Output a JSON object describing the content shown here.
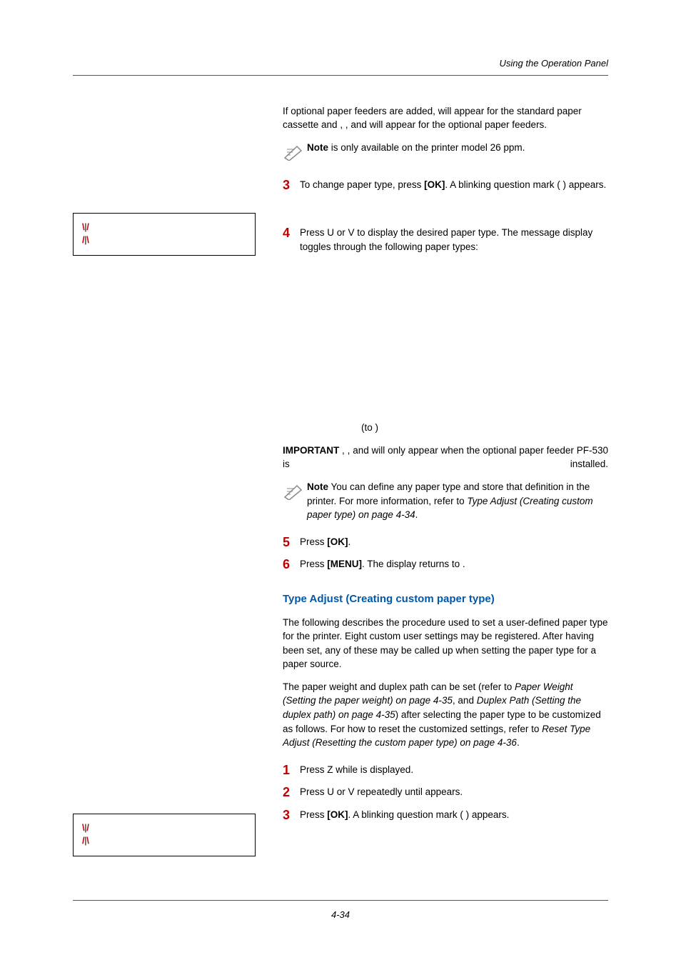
{
  "running_header": "Using the Operation Panel",
  "intro_paragraph": {
    "p1a": "If optional paper feeders are added, ",
    "p1b": " will appear for the standard paper cassette and ",
    "p1c": ", ",
    "p1d": ", and ",
    "p1e": " will appear for the optional paper feeders."
  },
  "note1": {
    "label": "Note",
    "text_a": " is only available on the printer model 26 ppm."
  },
  "step3": {
    "num": "3",
    "text_a": "To change paper type, press ",
    "ok": "[OK]",
    "text_b": ". A blinking question mark ( ) appears."
  },
  "step4": {
    "num": "4",
    "text_a": "Press ",
    "text_b": " or ",
    "text_c": " to display the desired paper type. The message display toggles through the following paper types:"
  },
  "to8": "(to  )",
  "important": {
    "label": "IMPORTANT",
    "sep1": " , ",
    "sep2": " , ",
    "and": " and ",
    "tail": " will only appear when the optional paper feeder PF-530 is installed."
  },
  "note2": {
    "label": "Note",
    "text": "  You can define any paper type and store that definition in the printer. For more information, refer to ",
    "link": "Type Adjust (Creating custom paper type) on page 4-34",
    "dot": "."
  },
  "step5": {
    "num": "5",
    "text_a": "Press ",
    "ok": "[OK]",
    "dot": "."
  },
  "step6": {
    "num": "6",
    "text_a": "Press ",
    "menu": "[MENU]",
    "text_b": ". The display returns to ",
    "dot": "."
  },
  "subheading": "Type Adjust (Creating custom paper type)",
  "body1": "The following describes the procedure used to set a user-defined paper type for the printer. Eight custom user settings may be registered. After having been set, any of these may be called up when setting the paper type for a paper source.",
  "body2": {
    "a": "The paper weight and duplex path can be set (refer to ",
    "l1": "Paper Weight (Setting the paper weight) on page 4-35",
    "b": ", and ",
    "l2": "Duplex Path (Setting the duplex path) on page 4-35",
    "c": ") after selecting the paper type to be customized as follows. For how to reset the customized settings, refer to ",
    "l3": "Reset Type Adjust (Resetting the custom paper type) on page 4-36",
    "d": "."
  },
  "bstep1": {
    "num": "1",
    "a": "Press ",
    "b": " while ",
    "c": " is displayed."
  },
  "bstep2": {
    "num": "2",
    "a": "Press ",
    "b": " or ",
    "c": " repeatedly until ",
    "d": " appears."
  },
  "bstep3": {
    "num": "3",
    "a": "Press ",
    "ok": "[OK]",
    "b": ". A blinking question mark ( ) appears."
  },
  "page_number": "4-34",
  "glyph_up": "U",
  "glyph_down": "V",
  "glyph_right": "Z"
}
